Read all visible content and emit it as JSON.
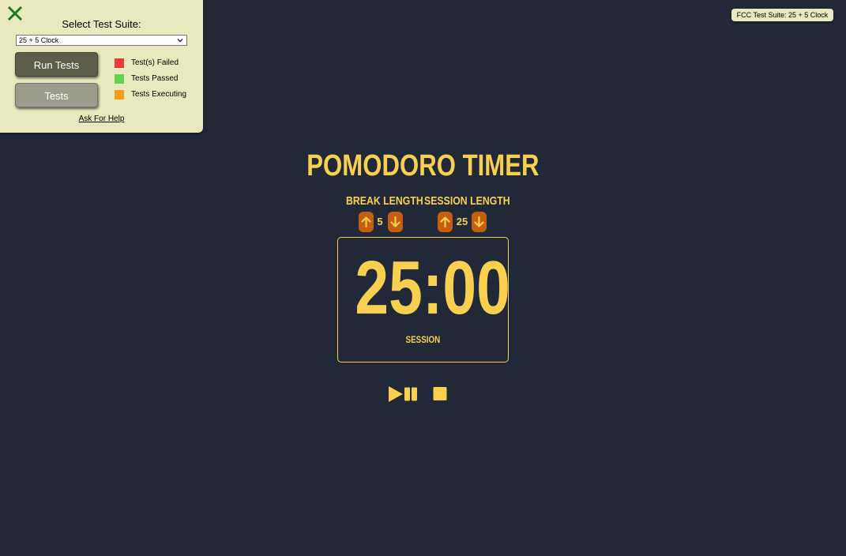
{
  "fcc_panel": {
    "title": "Select Test Suite:",
    "selected_suite": "25 + 5 Clock",
    "run_tests_label": "Run Tests",
    "tests_label": "Tests",
    "legend": [
      {
        "label": "Test(s) Failed",
        "color": "#ec3a36"
      },
      {
        "label": "Tests Passed",
        "color": "#65d151"
      },
      {
        "label": "Tests Executing",
        "color": "#f59c1a"
      }
    ],
    "help_link": "Ask For Help",
    "close_icon": "close-icon",
    "close_color": "#1d7a1d"
  },
  "fcc_badge": "FCC Test Suite: 25 + 5 Clock",
  "app": {
    "title": "POMODORO TIMER",
    "break_label": "BREAK LENGTH",
    "break_length": "5",
    "session_label": "SESSION LENGTH",
    "session_length": "25",
    "time_left": "25:00",
    "timer_label": "SESSION",
    "controls": [
      "play-pause-icon",
      "reset-icon"
    ]
  },
  "colors": {
    "background": "#212939",
    "accent": "#f9cf4f",
    "arrow_button": "#c55e0f"
  }
}
